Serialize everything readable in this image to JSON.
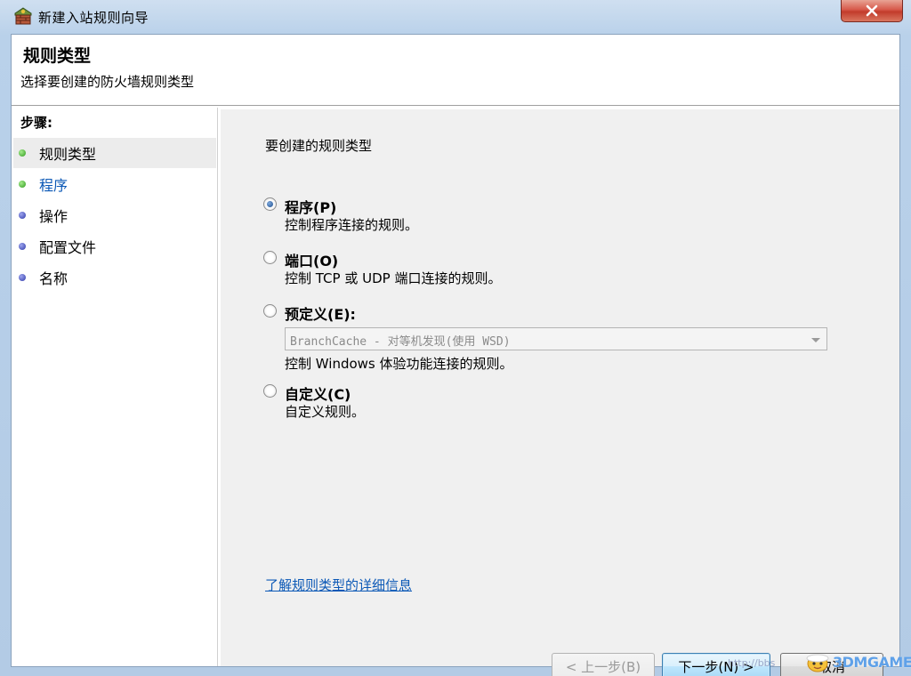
{
  "window": {
    "title": "新建入站规则向导"
  },
  "header": {
    "title": "规则类型",
    "subtitle": "选择要创建的防火墙规则类型"
  },
  "steps": {
    "heading": "步骤:",
    "items": [
      {
        "label": "规则类型",
        "state": "current"
      },
      {
        "label": "程序",
        "state": "upcoming"
      },
      {
        "label": "操作",
        "state": "upcoming"
      },
      {
        "label": "配置文件",
        "state": "upcoming"
      },
      {
        "label": "名称",
        "state": "upcoming"
      }
    ]
  },
  "main": {
    "heading": "要创建的规则类型",
    "options": [
      {
        "label": "程序(P)",
        "description": "控制程序连接的规则。",
        "checked": true
      },
      {
        "label": "端口(O)",
        "description": "控制 TCP 或 UDP 端口连接的规则。",
        "checked": false
      },
      {
        "label": "预定义(E):",
        "description": "控制 Windows 体验功能连接的规则。",
        "checked": false,
        "combo_value": "BranchCache - 对等机发现(使用 WSD)"
      },
      {
        "label": "自定义(C)",
        "description": "自定义规则。",
        "checked": false
      }
    ],
    "learn_link": "了解规则类型的详细信息"
  },
  "buttons": {
    "back": "< 上一步(B)",
    "next": "下一步(N) >",
    "cancel": "取消"
  },
  "watermark": {
    "url": "http://bbs",
    "brand": "3DMGAME"
  },
  "colors": {
    "link": "#0b58b6",
    "step_done_dot": "#2f9a1d",
    "step_pending_dot": "#2e39a8",
    "close_button": "#c23b2b"
  }
}
